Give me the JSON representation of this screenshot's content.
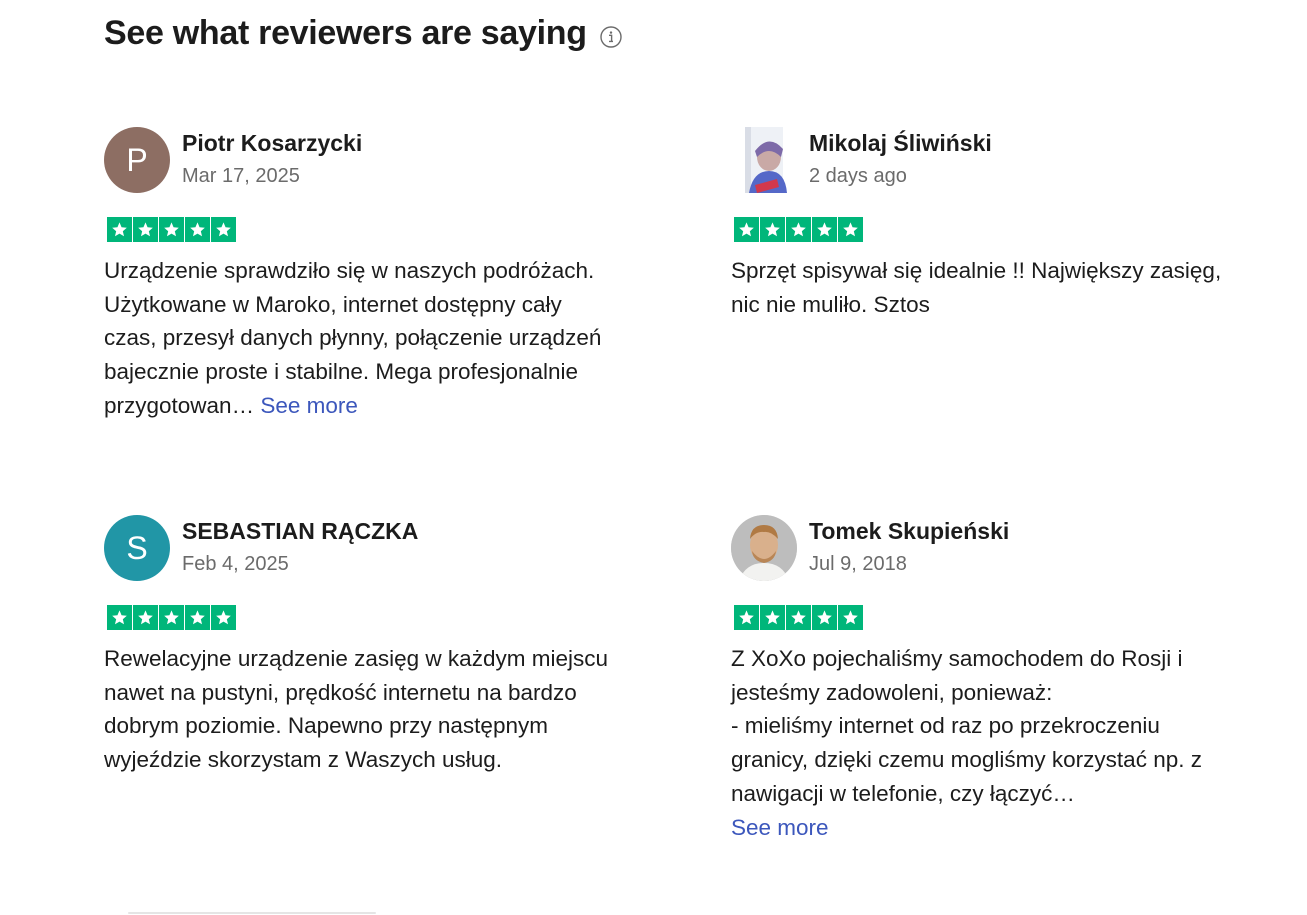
{
  "header": {
    "title": "See what reviewers are saying",
    "info_icon": "info-circle-icon"
  },
  "colors": {
    "star_green": "#00b67a",
    "link_blue": "#3c57bc",
    "avatar_brown": "#8d6e63",
    "avatar_teal": "#2196a6"
  },
  "reviews": [
    {
      "name": "Piotr Kosarzycki",
      "date": "Mar 17, 2025",
      "initial": "P",
      "rating": 5,
      "text": "Urządzenie sprawdziło się w naszych podróżach. Użytkowane w Maroko, internet dostępny cały czas, przesył danych płynny, połączenie urządzeń bajecznie proste i stabilne. Mega profesjonalnie przygotowan… ",
      "see_more": "See more"
    },
    {
      "name": "Mikolaj Śliwiński",
      "date": "2 days ago",
      "initial": "",
      "rating": 5,
      "text": "Sprzęt spisywał się idealnie !! Największy zasięg, nic nie muliło. Sztos",
      "see_more": ""
    },
    {
      "name": "SEBASTIAN RĄCZKA",
      "date": "Feb 4, 2025",
      "initial": "S",
      "rating": 5,
      "text": "Rewelacyjne urządzenie zasięg w każdym miejscu nawet na pustyni, prędkość internetu na bardzo dobrym poziomie. Napewno przy następnym wyjeździe skorzystam z Waszych usług.",
      "see_more": ""
    },
    {
      "name": "Tomek Skupieński",
      "date": "Jul 9, 2018",
      "initial": "",
      "rating": 5,
      "text": "Z XoXo pojechaliśmy samochodem do Rosji i jesteśmy zadowoleni, ponieważ:\n- mieliśmy internet od raz po przekroczeniu granicy, dzięki czemu mogliśmy korzystać np. z nawigacji w telefonie, czy łączyć…\n",
      "see_more": "See more"
    }
  ]
}
